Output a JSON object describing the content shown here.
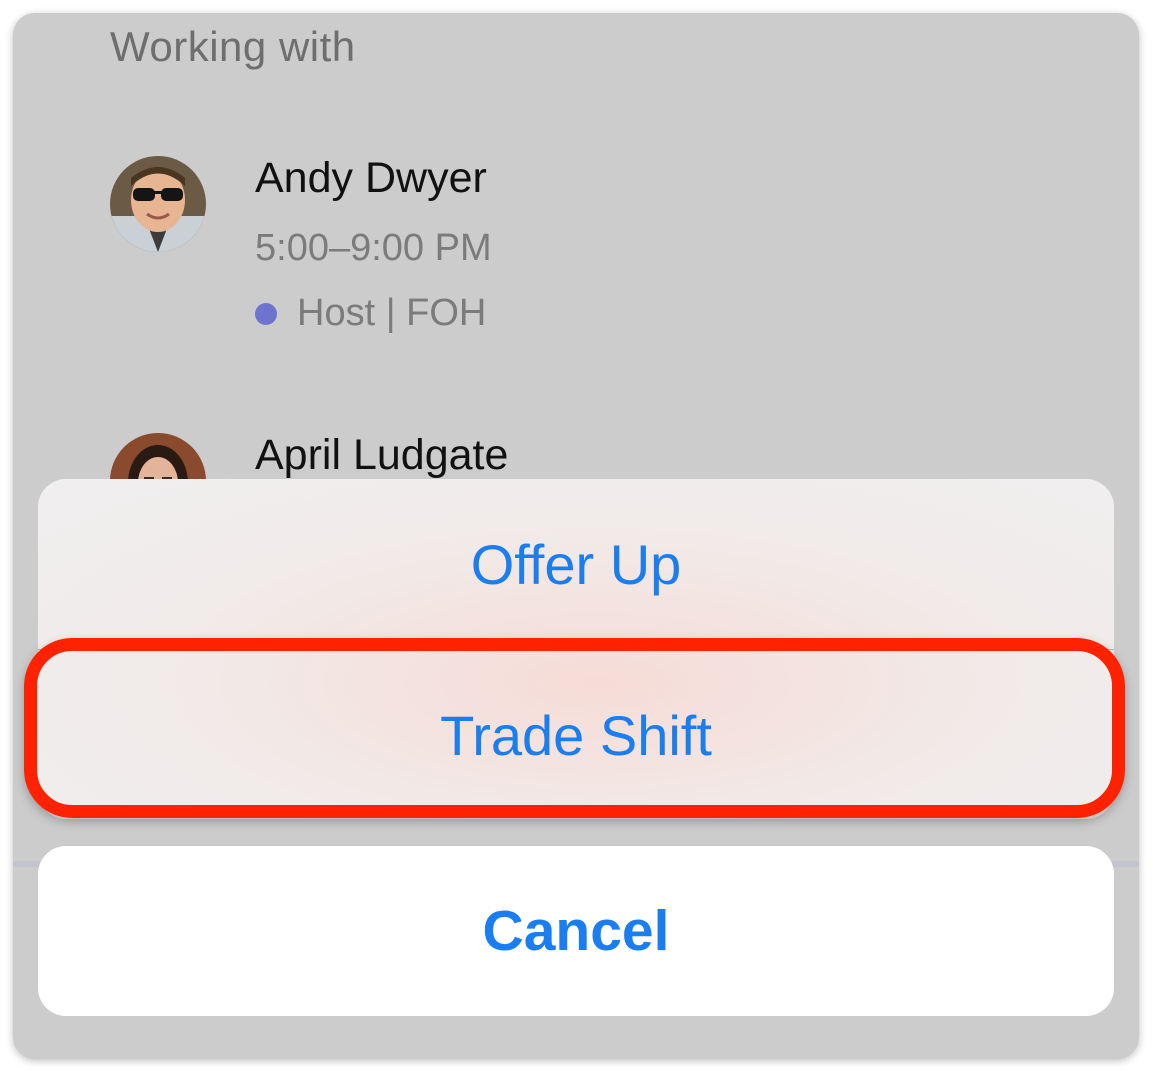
{
  "section": {
    "title": "Working with"
  },
  "coworkers": [
    {
      "name": "Andy Dwyer",
      "time": "5:00–9:00 PM",
      "role": "Host | FOH",
      "role_color": "#6c74d0"
    },
    {
      "name": "April Ludgate"
    }
  ],
  "action_sheet": {
    "actions": [
      {
        "label": "Offer Up"
      },
      {
        "label": "Trade Shift"
      }
    ],
    "cancel_label": "Cancel",
    "accent_color": "#1a7df0",
    "highlight_color": "#ff2200"
  }
}
